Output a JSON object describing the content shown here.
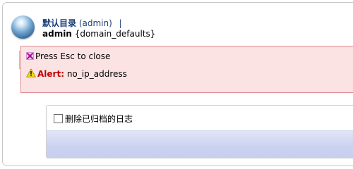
{
  "header": {
    "catalog_label": "默认目录",
    "account_name": "(admin)",
    "separator": "|",
    "user_name": "admin",
    "domain": "{domain_defaults}"
  },
  "alert": {
    "close_text": "Press Esc to close",
    "label": "Alert:",
    "message": "no_ip_address"
  },
  "panel": {
    "checkbox_label": "删除已归档的日志",
    "checkbox_checked": false
  },
  "colors": {
    "alert_bg": "#fbe3e4",
    "alert_border": "#e08b91",
    "alert_label": "#c00000",
    "link_blue": "#1a3f78",
    "band": "#cbd2f0"
  },
  "icons": [
    "globe-icon",
    "close-icon",
    "warning-icon"
  ]
}
